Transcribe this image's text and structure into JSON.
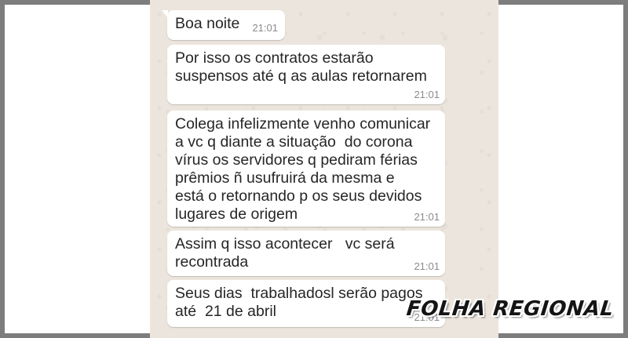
{
  "messages": [
    {
      "text": "Boa noite",
      "time": "21:01"
    },
    {
      "text": "Por isso os contratos estarão\nsuspensos até q as aulas retornarem",
      "time": "21:01"
    },
    {
      "text": "Colega infelizmente venho comunicar\na vc q diante a situação  do corona\nvírus os servidores q pediram férias\nprêmios ñ usufruirá da mesma e\nestá o retornando p os seus devidos\nlugares de origem",
      "time": "21:01"
    },
    {
      "text": "Assim q isso acontecer   vc será\nrecontrada",
      "time": "21:01"
    },
    {
      "text": "Seus dias  trabalhadosl serão pagos\naté  21 de abril",
      "time": "21:01"
    }
  ],
  "watermark": "FOLHA REGIONAL",
  "colors": {
    "chat_background": "#ece5dd",
    "bubble": "#ffffff",
    "time_text": "#8a8a8a",
    "outer_border": "#7d7d7d"
  }
}
